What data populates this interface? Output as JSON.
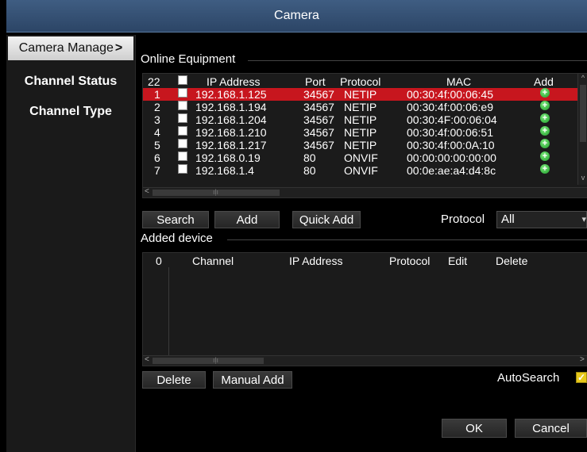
{
  "window": {
    "title": "Camera"
  },
  "sidebar": {
    "items": [
      {
        "label": "Camera Manage",
        "chevron": ">",
        "active": true
      },
      {
        "label": "Channel Status",
        "active": false
      },
      {
        "label": "Channel Type",
        "active": false
      }
    ]
  },
  "online": {
    "group_label": "Online Equipment",
    "count": "22",
    "headers": {
      "ip": "IP Address",
      "port": "Port",
      "protocol": "Protocol",
      "mac": "MAC",
      "add": "Add"
    },
    "rows": [
      {
        "no": "1",
        "ip": "192.168.1.125",
        "port": "34567",
        "protocol": "NETIP",
        "mac": "00:30:4f:00:06:45"
      },
      {
        "no": "2",
        "ip": "192.168.1.194",
        "port": "34567",
        "protocol": "NETIP",
        "mac": "00:30:4f:00:06:e9"
      },
      {
        "no": "3",
        "ip": "192.168.1.204",
        "port": "34567",
        "protocol": "NETIP",
        "mac": "00:30:4F:00:06:04"
      },
      {
        "no": "4",
        "ip": "192.168.1.210",
        "port": "34567",
        "protocol": "NETIP",
        "mac": "00:30:4f:00:06:51"
      },
      {
        "no": "5",
        "ip": "192.168.1.217",
        "port": "34567",
        "protocol": "NETIP",
        "mac": "00:30:4f:00:0A:10"
      },
      {
        "no": "6",
        "ip": "192.168.0.19",
        "port": "80",
        "protocol": "ONVIF",
        "mac": "00:00:00:00:00:00"
      },
      {
        "no": "7",
        "ip": "192.168.1.4",
        "port": "80",
        "protocol": "ONVIF",
        "mac": "00:0e:ae:a4:d4:8c"
      }
    ],
    "selected_row": 0
  },
  "toolbar": {
    "search": "Search",
    "add": "Add",
    "quick_add": "Quick Add",
    "protocol_label": "Protocol",
    "protocol_value": "All"
  },
  "added": {
    "group_label": "Added device",
    "count": "0",
    "headers": {
      "channel": "Channel",
      "ip": "IP Address",
      "protocol": "Protocol",
      "edit": "Edit",
      "delete": "Delete"
    }
  },
  "bottom": {
    "delete": "Delete",
    "manual_add": "Manual Add",
    "autosearch_label": "AutoSearch",
    "autosearch_checked": true,
    "ok": "OK",
    "cancel": "Cancel"
  },
  "colors": {
    "title_bar": "#3f5d82",
    "selected_row": "#c7161e",
    "add_icon": "#1e9e2a",
    "checkbox_checked": "#e8c81a"
  }
}
